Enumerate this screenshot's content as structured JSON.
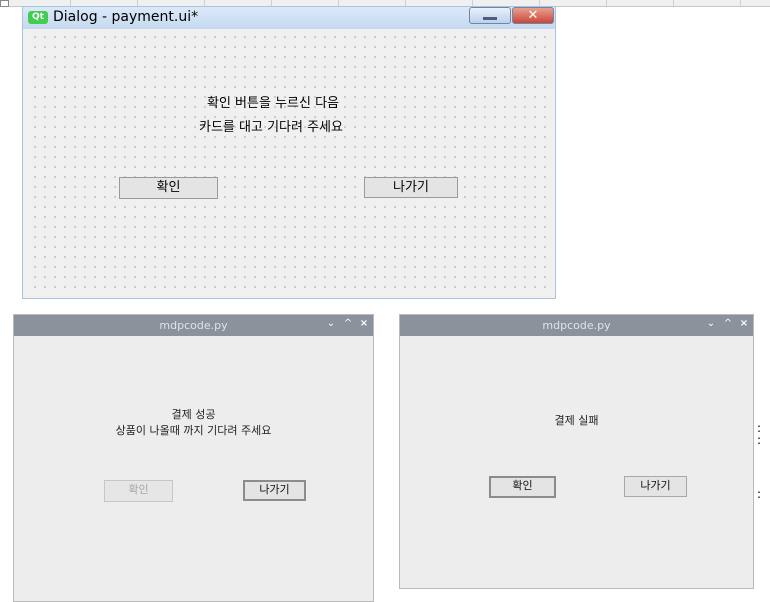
{
  "designer": {
    "title": "Dialog - payment.ui*",
    "logo": "Qt",
    "close_glyph": "✕",
    "label_line1": "확인 버튼을 누르신 다음",
    "label_line2": "카드를 대고 기다려 주세요",
    "confirm_label": "확인",
    "exit_label": "나가기"
  },
  "success_window": {
    "title": "mdpcode.py",
    "line1": "결제 성공",
    "line2": "상품이 나올때 까지 기다려 주세요",
    "confirm_label": "확인",
    "exit_label": "나가기"
  },
  "fail_window": {
    "title": "mdpcode.py",
    "line1": "결제 실패",
    "confirm_label": "확인",
    "exit_label": "나가기"
  },
  "controls": {
    "min_glyph": "⌄",
    "max_glyph": "^",
    "close_glyph": "×"
  }
}
